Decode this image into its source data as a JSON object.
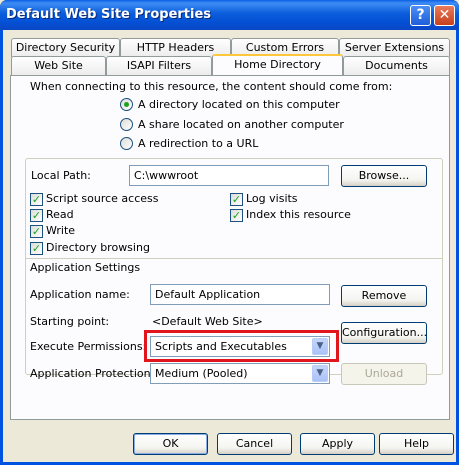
{
  "window": {
    "title": "Default Web Site Properties"
  },
  "titlebar": {
    "help_glyph": "?",
    "close_glyph": "✕"
  },
  "tabs_row1": [
    "Directory Security",
    "HTTP Headers",
    "Custom Errors",
    "Server Extensions"
  ],
  "tabs_row2": [
    "Web Site",
    "ISAPI Filters",
    "Home Directory",
    "Documents"
  ],
  "active_tab": "Home Directory",
  "content": {
    "prompt": "When connecting to this resource, the content should come from:",
    "source_options": [
      {
        "label": "A directory located on this computer",
        "selected": true
      },
      {
        "label": "A share located on another computer",
        "selected": false
      },
      {
        "label": "A redirection to a URL",
        "selected": false
      }
    ],
    "local_path_label": "Local Path:",
    "local_path_value": "C:\\wwwroot",
    "browse_label": "Browse...",
    "permissions_left": [
      {
        "label": "Script source access",
        "checked": true
      },
      {
        "label": "Read",
        "checked": true
      },
      {
        "label": "Write",
        "checked": true
      },
      {
        "label": "Directory browsing",
        "checked": true
      }
    ],
    "permissions_right": [
      {
        "label": "Log visits",
        "checked": true
      },
      {
        "label": "Index this resource",
        "checked": true
      }
    ],
    "app_settings_heading": "Application Settings",
    "app_name_label": "Application name:",
    "app_name_value": "Default Application",
    "remove_label": "Remove",
    "starting_point_label": "Starting point:",
    "starting_point_value": "<Default Web Site>",
    "configuration_label": "Configuration...",
    "execute_perm_label": "Execute Permissions:",
    "execute_perm_value": "Scripts and Executables",
    "app_protection_label": "Application Protection:",
    "app_protection_value": "Medium (Pooled)",
    "unload_label": "Unload"
  },
  "footer": {
    "ok": "OK",
    "cancel": "Cancel",
    "apply": "Apply",
    "help": "Help"
  },
  "colors": {
    "highlight_border": "#e0161c",
    "titlebar": "#0b5ddc",
    "active_tab_accent": "#ffc83c"
  }
}
